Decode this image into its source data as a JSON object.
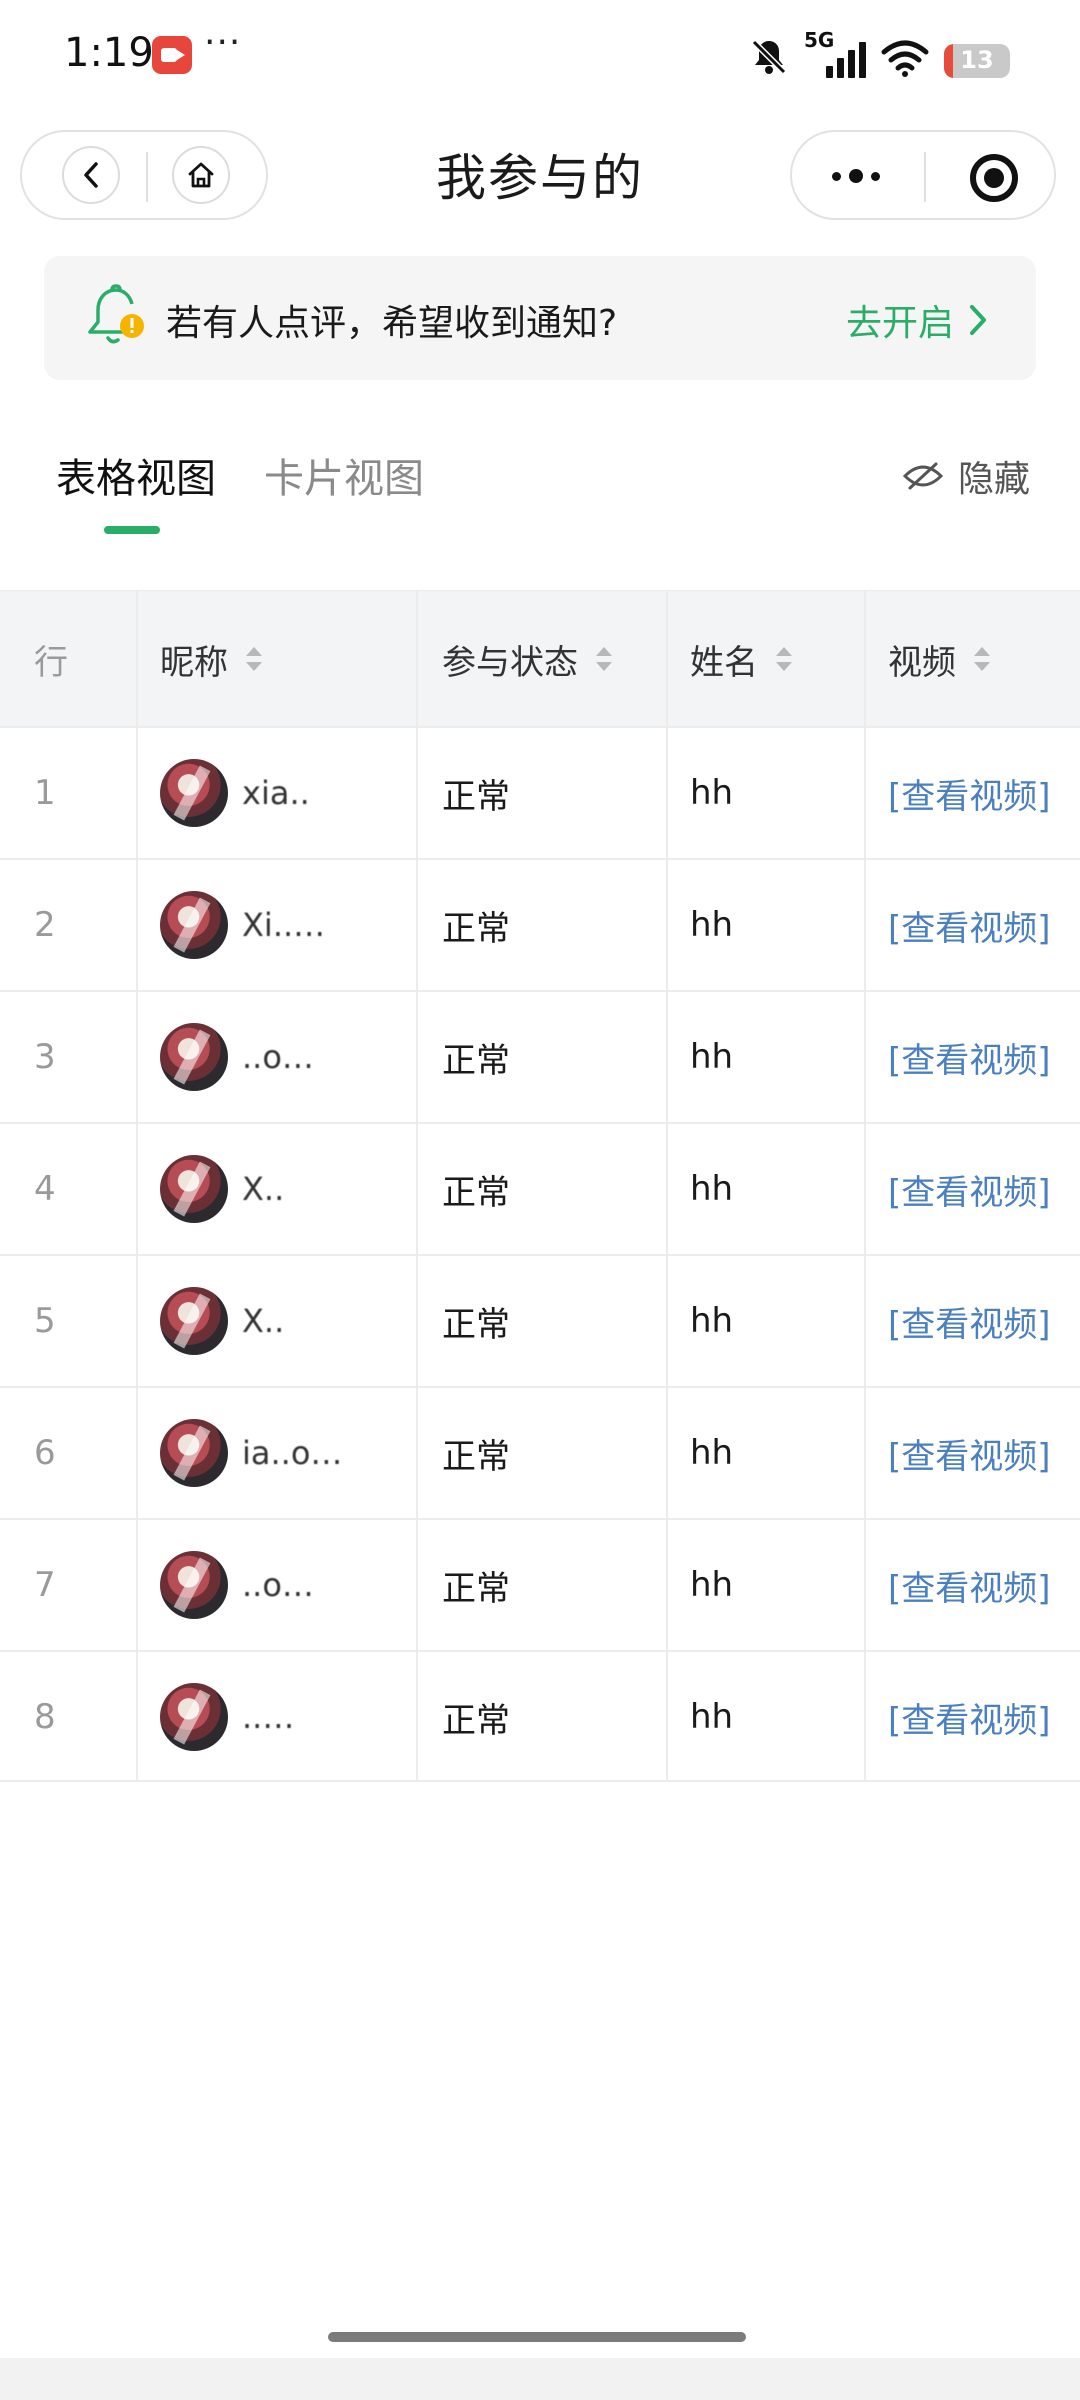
{
  "status_bar": {
    "time": "1:19",
    "more": "···",
    "network": "5G",
    "battery": "13",
    "battery_level": 0.13,
    "record_icon": "video-record-icon",
    "colors": {
      "record": "#e6463c",
      "battery_low": "#e64b3c"
    }
  },
  "nav": {
    "title": "我参与的",
    "back_icon": "chevron-left-icon",
    "home_icon": "home-icon",
    "more_icon": "more-dots-icon",
    "close_icon": "target-icon"
  },
  "notice": {
    "text": "若有人点评，希望收到通知?",
    "action": "去开启",
    "icon": "bell-alert-icon",
    "accent": "#2aae67"
  },
  "tabs": {
    "items": [
      {
        "label": "表格视图",
        "active": true
      },
      {
        "label": "卡片视图",
        "active": false
      }
    ],
    "hide_label": "隐藏",
    "hide_icon": "eye-off-icon"
  },
  "table": {
    "columns": [
      "行",
      "昵称",
      "参与状态",
      "姓名",
      "视频"
    ],
    "rows": [
      {
        "row": "1",
        "nickname": "xia..",
        "status": "正常",
        "name": "hh",
        "video": "[查看视频]"
      },
      {
        "row": "2",
        "nickname": "Xi..…",
        "status": "正常",
        "name": "hh",
        "video": "[查看视频]"
      },
      {
        "row": "3",
        "nickname": "..o…",
        "status": "正常",
        "name": "hh",
        "video": "[查看视频]"
      },
      {
        "row": "4",
        "nickname": "X..",
        "status": "正常",
        "name": "hh",
        "video": "[查看视频]"
      },
      {
        "row": "5",
        "nickname": "X..",
        "status": "正常",
        "name": "hh",
        "video": "[查看视频]"
      },
      {
        "row": "6",
        "nickname": "ia..o…",
        "status": "正常",
        "name": "hh",
        "video": "[查看视频]"
      },
      {
        "row": "7",
        "nickname": "..o…",
        "status": "正常",
        "name": "hh",
        "video": "[查看视频]"
      },
      {
        "row": "8",
        "nickname": "..…",
        "status": "正常",
        "name": "hh",
        "video": "[查看视频]"
      }
    ],
    "link_color": "#4a7fc0"
  }
}
